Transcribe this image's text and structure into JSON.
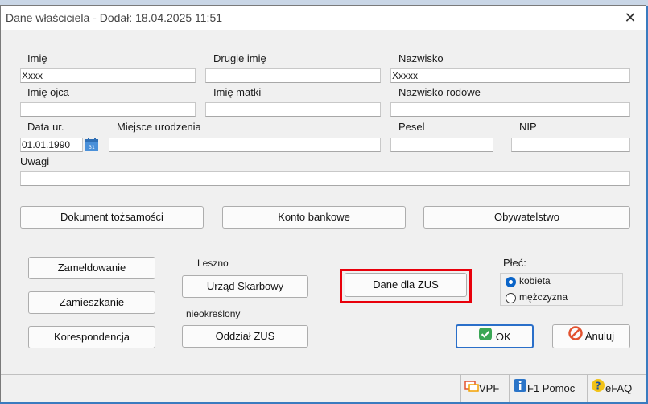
{
  "window": {
    "title": "Dane właściciela - Dodał:  18.04.2025 11:51"
  },
  "fields": {
    "imie": {
      "label": "Imię",
      "value": "Xxxx"
    },
    "drugie_imie": {
      "label": "Drugie imię",
      "value": ""
    },
    "nazwisko": {
      "label": "Nazwisko",
      "value": "Xxxxx"
    },
    "imie_ojca": {
      "label": "Imię ojca",
      "value": ""
    },
    "imie_matki": {
      "label": "Imię matki",
      "value": ""
    },
    "nazwisko_rodowe": {
      "label": "Nazwisko rodowe",
      "value": ""
    },
    "data_ur": {
      "label": "Data ur.",
      "value": "01.01.1990"
    },
    "miejsce_urodzenia": {
      "label": "Miejsce urodzenia",
      "value": ""
    },
    "pesel": {
      "label": "Pesel",
      "value": ""
    },
    "nip": {
      "label": "NIP",
      "value": ""
    },
    "uwagi": {
      "label": "Uwagi",
      "value": ""
    }
  },
  "buttons": {
    "dokument": "Dokument tożsamości",
    "konto": "Konto bankowe",
    "obywatelstwo": "Obywatelstwo",
    "zameldowanie": "Zameldowanie",
    "zamieszkanie": "Zamieszkanie",
    "korespondencja": "Korespondencja",
    "urzad": "Urząd Skarbowy",
    "oddzial": "Oddział ZUS",
    "dane_zus": "Dane dla ZUS",
    "ok": "OK",
    "anuluj": "Anuluj"
  },
  "info": {
    "urzad_value": "Leszno",
    "oddzial_value": "nieokreślony"
  },
  "plec": {
    "label": "Płeć:",
    "options": [
      "kobieta",
      "mężczyzna"
    ],
    "selected": "kobieta"
  },
  "statusbar": {
    "vpf": "VPF",
    "pomoc": "F1 Pomoc",
    "efaq": "eFAQ"
  },
  "colors": {
    "highlight": "#e8000b",
    "radio_accent": "#0a64c8",
    "ok_icon": "#3aa655",
    "cancel_icon": "#e2522f",
    "help_icon": "#2a74c8",
    "efaq_icon": "#f2c318"
  }
}
